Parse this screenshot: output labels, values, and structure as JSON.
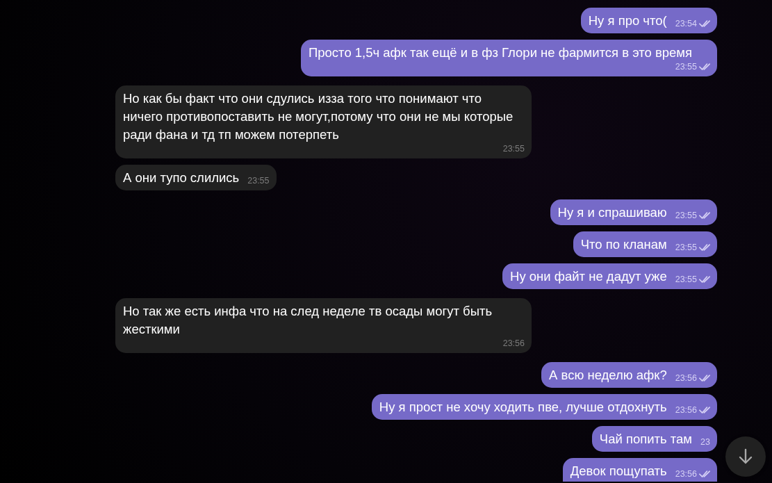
{
  "messages": [
    {
      "kind": "outgoing",
      "text": "Ну я про что(",
      "time": "23:54",
      "read": true
    },
    {
      "kind": "outgoing",
      "text": "Просто 1,5ч афк так ещё и в фз Глори не фармится в это время",
      "time": "23:55",
      "read": true
    },
    {
      "kind": "incoming",
      "text": "Но как бы факт что они сдулись изза того что понимают что ничего противопоставить не могут,потому что они не мы которые ради фана и тд тп можем потерпеть",
      "time": "23:55"
    },
    {
      "kind": "incoming",
      "text": "А они тупо слились",
      "time": "23:55"
    },
    {
      "kind": "outgoing",
      "text": "Ну я и спрашиваю",
      "time": "23:55",
      "read": true
    },
    {
      "kind": "outgoing",
      "text": "Что по кланам",
      "time": "23:55",
      "read": true
    },
    {
      "kind": "outgoing",
      "text": "Ну они файт не дадут уже",
      "time": "23:55",
      "read": true
    },
    {
      "kind": "incoming",
      "text": "Но так же есть инфа что на след неделе тв осады могут быть жесткими",
      "time": "23:56"
    },
    {
      "kind": "outgoing",
      "text": "А всю неделю афк?",
      "time": "23:56",
      "read": true
    },
    {
      "kind": "outgoing",
      "text": "Ну я прост не хочу ходить пве, лучше отдохнуть",
      "time": "23:56",
      "read": true
    },
    {
      "kind": "outgoing",
      "text": "Чай попить там",
      "time": "23"
    },
    {
      "kind": "outgoing",
      "text": "Девок пощупать",
      "time": "23:56",
      "read": true
    }
  ],
  "scroll_down_button": {
    "visible": true
  }
}
